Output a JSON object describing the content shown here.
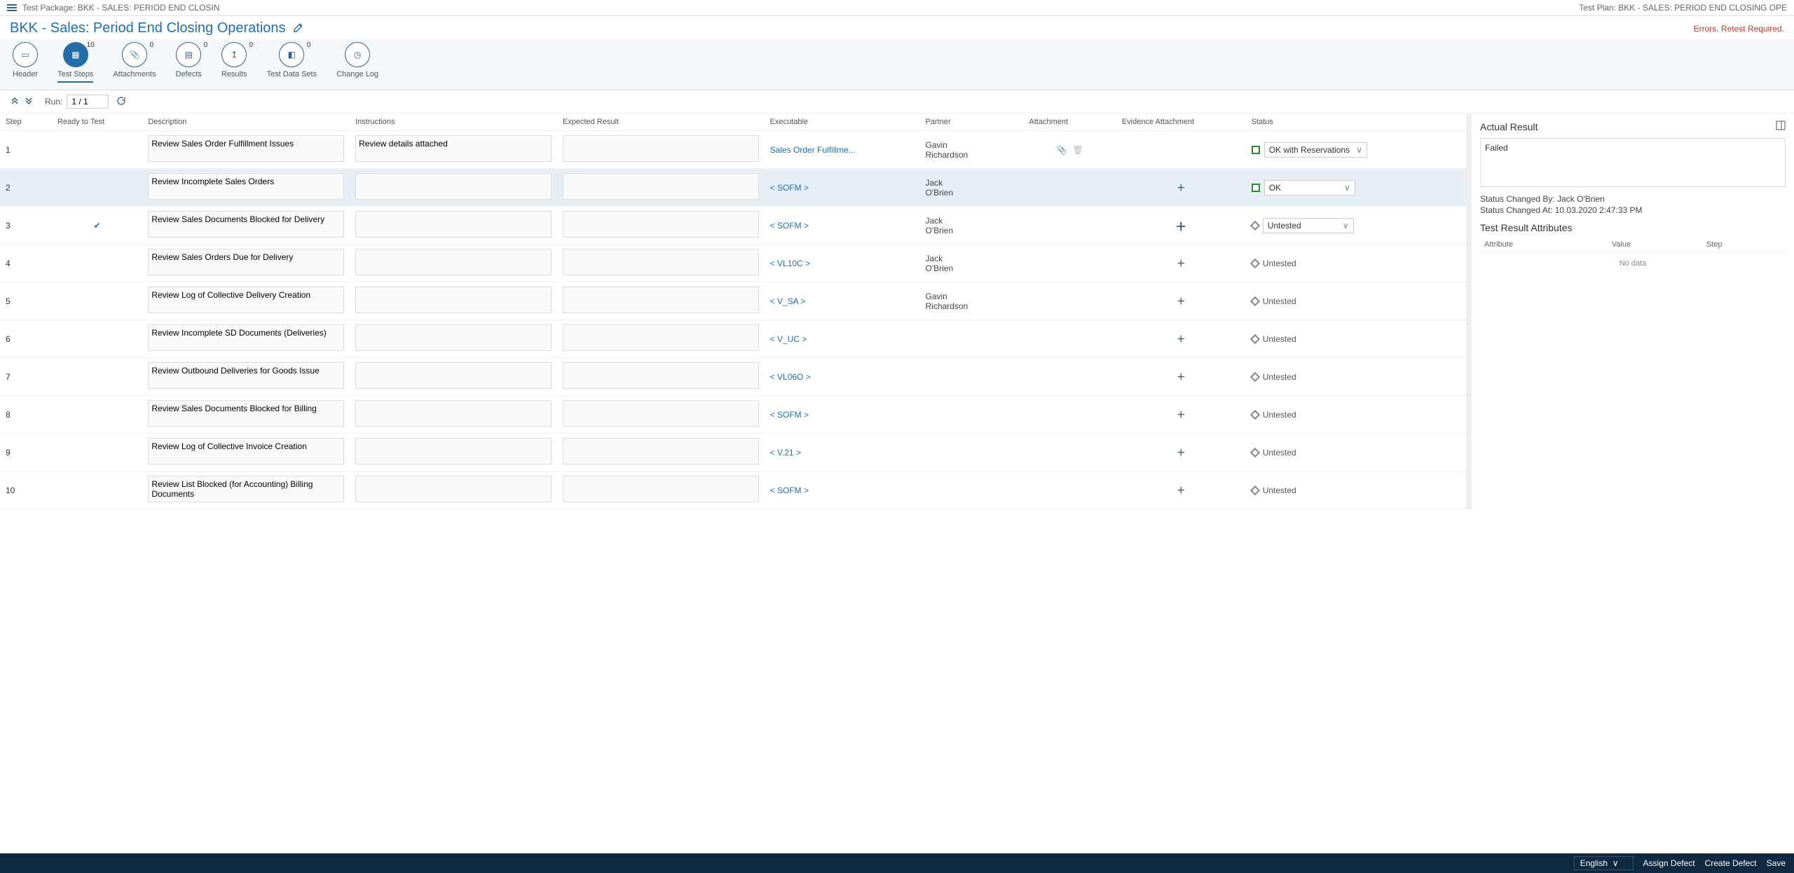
{
  "top": {
    "package_label": "Test Package: BKK - SALES: PERIOD END CLOSIN",
    "plan_label": "Test Plan: BKK - SALES: PERIOD END CLOSING OPE"
  },
  "title": "BKK - Sales: Period End Closing Operations",
  "errors_label": "Errors. Retest Required.",
  "tabs": [
    {
      "label": "Header",
      "badge": ""
    },
    {
      "label": "Test Steps",
      "badge": "10"
    },
    {
      "label": "Attachments",
      "badge": "0"
    },
    {
      "label": "Defects",
      "badge": "0"
    },
    {
      "label": "Results",
      "badge": "0"
    },
    {
      "label": "Test Data Sets",
      "badge": "0"
    },
    {
      "label": "Change Log",
      "badge": ""
    }
  ],
  "run": {
    "label": "Run:",
    "value": "1 / 1"
  },
  "columns": {
    "step": "Step",
    "ready": "Ready to Test",
    "desc": "Description",
    "instr": "Instructions",
    "exp": "Expected Result",
    "exec": "Executable",
    "partner": "Partner",
    "attach": "Attachment",
    "evidence": "Evidence Attachment",
    "status": "Status"
  },
  "rows": [
    {
      "step": "1",
      "ready": "",
      "desc": "Review Sales Order Fulfillment Issues",
      "instr": "Review details attached",
      "expected": "",
      "exec": "Sales Order Fulfillme...",
      "partner": "Gavin\nRichardson",
      "attachment": "clip",
      "evidence": "",
      "statusType": "green",
      "status": "OK with Reservations",
      "selectable": true
    },
    {
      "step": "2",
      "ready": "",
      "desc": "Review Incomplete Sales Orders",
      "instr": "",
      "expected": "",
      "exec": "< SOFM >",
      "partner": "Jack\nO'Brien",
      "attachment": "",
      "evidence": "plus",
      "statusType": "green",
      "status": "OK",
      "selectable": true,
      "selected": true
    },
    {
      "step": "3",
      "ready": "check",
      "desc": "Review Sales Documents Blocked for Delivery",
      "instr": "",
      "expected": "",
      "exec": "< SOFM >",
      "partner": "Jack\nO'Brien",
      "attachment": "",
      "evidence": "plusbig",
      "statusType": "diam",
      "status": "Untested",
      "selectable": true
    },
    {
      "step": "4",
      "ready": "",
      "desc": "Review Sales Orders Due for Delivery",
      "instr": "",
      "expected": "",
      "exec": "< VL10C >",
      "partner": "Jack\nO'Brien",
      "attachment": "",
      "evidence": "plus",
      "statusType": "diam",
      "status": "Untested",
      "plain": true
    },
    {
      "step": "5",
      "ready": "",
      "desc": "Review Log of Collective Delivery Creation",
      "instr": "",
      "expected": "",
      "exec": "< V_SA >",
      "partner": "Gavin\nRichardson",
      "attachment": "",
      "evidence": "plus",
      "statusType": "diam",
      "status": "Untested",
      "plain": true
    },
    {
      "step": "6",
      "ready": "",
      "desc": "Review Incomplete SD Documents (Deliveries)",
      "instr": "",
      "expected": "",
      "exec": "< V_UC >",
      "partner": "",
      "attachment": "",
      "evidence": "plus",
      "statusType": "diam",
      "status": "Untested",
      "plain": true
    },
    {
      "step": "7",
      "ready": "",
      "desc": "Review Outbound Deliveries for Goods Issue",
      "instr": "",
      "expected": "",
      "exec": "< VL06O >",
      "partner": "",
      "attachment": "",
      "evidence": "plus",
      "statusType": "diam",
      "status": "Untested",
      "plain": true
    },
    {
      "step": "8",
      "ready": "",
      "desc": "Review Sales Documents Blocked for Billing",
      "instr": "",
      "expected": "",
      "exec": "< SOFM >",
      "partner": "",
      "attachment": "",
      "evidence": "plus",
      "statusType": "diam",
      "status": "Untested",
      "plain": true
    },
    {
      "step": "9",
      "ready": "",
      "desc": "Review Log of Collective Invoice Creation",
      "instr": "",
      "expected": "",
      "exec": "< V.21 >",
      "partner": "",
      "attachment": "",
      "evidence": "plus",
      "statusType": "diam",
      "status": "Untested",
      "plain": true
    },
    {
      "step": "10",
      "ready": "",
      "desc": "Review List Blocked (for Accounting) Billing Documents",
      "instr": "",
      "expected": "",
      "exec": "< SOFM >",
      "partner": "",
      "attachment": "",
      "evidence": "plus",
      "statusType": "diam",
      "status": "Untested",
      "plain": true
    }
  ],
  "side": {
    "title": "Actual Result",
    "result_text": "Failed",
    "changed_by_label": "Status Changed By:",
    "changed_by": "Jack O'Brien",
    "changed_at_label": "Status Changed At:",
    "changed_at": "10.03.2020 2:47:33 PM",
    "attr_title": "Test Result Attributes",
    "attr_cols": {
      "a": "Attribute",
      "b": "Value",
      "c": "Step"
    },
    "no_data": "No data"
  },
  "footer": {
    "language": "English",
    "assign": "Assign Defect",
    "create": "Create Defect",
    "save": "Save"
  }
}
